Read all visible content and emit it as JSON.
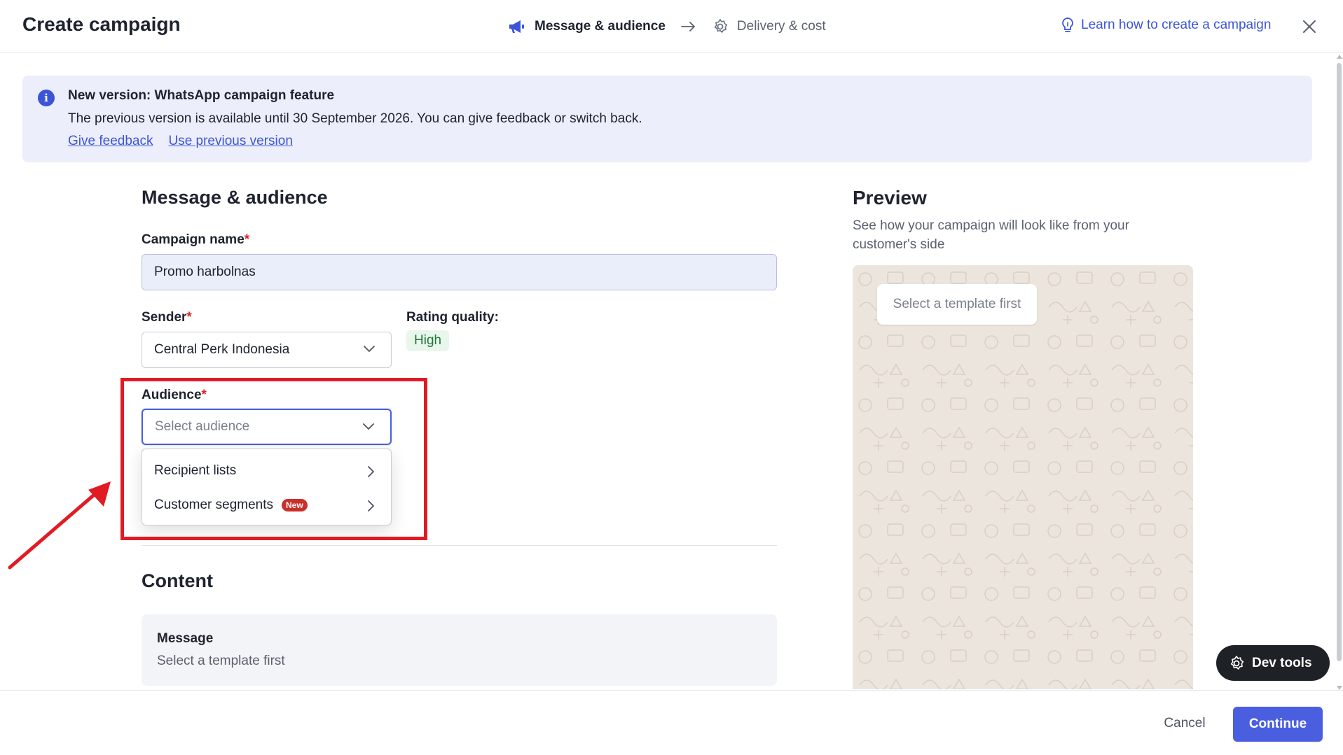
{
  "header": {
    "title": "Create campaign",
    "steps": [
      {
        "label": "Message & audience",
        "icon": "megaphone-icon",
        "state": "active"
      },
      {
        "label": "Delivery & cost",
        "icon": "gear-icon",
        "state": "inactive"
      }
    ],
    "learn_link": "Learn how to create a campaign"
  },
  "banner": {
    "title": "New version: WhatsApp campaign feature",
    "text": "The previous version is available until 30 September 2026. You can give feedback or switch back.",
    "link_feedback": "Give feedback",
    "link_previous": "Use previous version"
  },
  "form": {
    "section_title": "Message & audience",
    "campaign_name_label": "Campaign name",
    "campaign_name_value": "Promo harbolnas",
    "sender_label": "Sender",
    "sender_value": "Central Perk Indonesia",
    "rating_label": "Rating quality:",
    "rating_value": "High",
    "audience_label": "Audience",
    "audience_placeholder": "Select audience",
    "required_mark": "*",
    "audience_options": [
      {
        "label": "Recipient lists",
        "badge": ""
      },
      {
        "label": "Customer segments",
        "badge": "New"
      }
    ]
  },
  "content": {
    "section_title": "Content",
    "message_title": "Message",
    "message_sub": "Select a template first"
  },
  "preview": {
    "title": "Preview",
    "subtitle": "See how your campaign will look like from your customer's side",
    "bubble_text": "Select a template first"
  },
  "footer": {
    "cancel_label": "Cancel",
    "continue_label": "Continue"
  },
  "devtools_label": "Dev tools",
  "colors": {
    "accent": "#3c55d6",
    "primary_button": "#4a5fe0",
    "highlight": "#e01b24",
    "banner_bg": "#eceffb",
    "preview_bg": "#ece5dd",
    "success": "#1f7a3a"
  }
}
